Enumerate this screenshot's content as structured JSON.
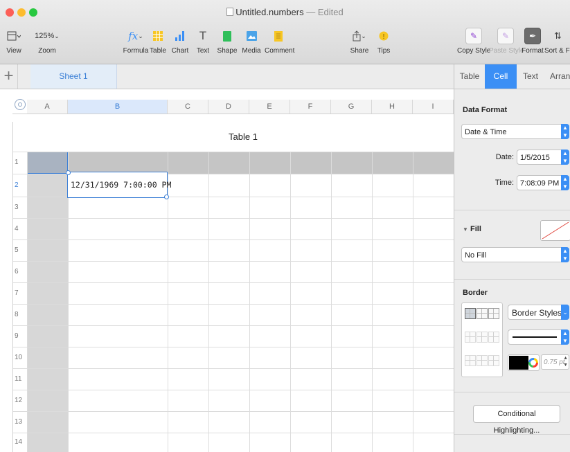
{
  "window": {
    "title": "Untitled.numbers",
    "title_status": "Edited",
    "separator": "—"
  },
  "toolbar": {
    "view_label": "View",
    "zoom_value": "125%",
    "zoom_label": "Zoom",
    "formula_label": "Formula",
    "table_label": "Table",
    "chart_label": "Chart",
    "text_label": "Text",
    "shape_label": "Shape",
    "media_label": "Media",
    "comment_label": "Comment",
    "share_label": "Share",
    "tips_label": "Tips",
    "copy_style_label": "Copy Style",
    "paste_style_label": "Paste Style",
    "format_label": "Format",
    "sort_filter_label": "Sort & Filter"
  },
  "sheets": {
    "add_label": "+",
    "tabs": [
      {
        "label": "Sheet 1",
        "selected": true
      }
    ]
  },
  "grid": {
    "columns": [
      "A",
      "B",
      "C",
      "D",
      "E",
      "F",
      "G",
      "H",
      "I"
    ],
    "selected_column": "B",
    "rows": [
      "1",
      "2",
      "3",
      "4",
      "5",
      "6",
      "7",
      "8",
      "9",
      "10",
      "11",
      "12",
      "13",
      "14"
    ],
    "selected_row": "2",
    "table_title": "Table 1",
    "editing_cell": {
      "ref": "B2",
      "value": "12/31/1969 7:00:00 PM"
    }
  },
  "inspector": {
    "tabs": [
      {
        "label": "Table",
        "selected": false
      },
      {
        "label": "Cell",
        "selected": true
      },
      {
        "label": "Text",
        "selected": false
      },
      {
        "label": "Arrange",
        "selected": false
      }
    ],
    "data_format": {
      "heading": "Data Format",
      "format_value": "Date & Time",
      "date_label": "Date:",
      "date_value": "1/5/2015",
      "time_label": "Time:",
      "time_value": "7:08:09 PM"
    },
    "fill": {
      "heading": "Fill",
      "value": "No Fill"
    },
    "border": {
      "heading": "Border",
      "style_label": "Border Styles",
      "width_value": "0.75 pt",
      "color": "#000000"
    },
    "conditional_button": "Conditional Highlighting..."
  },
  "colors": {
    "accent": "#3b8ff5",
    "close": "#fc5f57",
    "minimize": "#fdbc2e",
    "zoom": "#28c840"
  }
}
